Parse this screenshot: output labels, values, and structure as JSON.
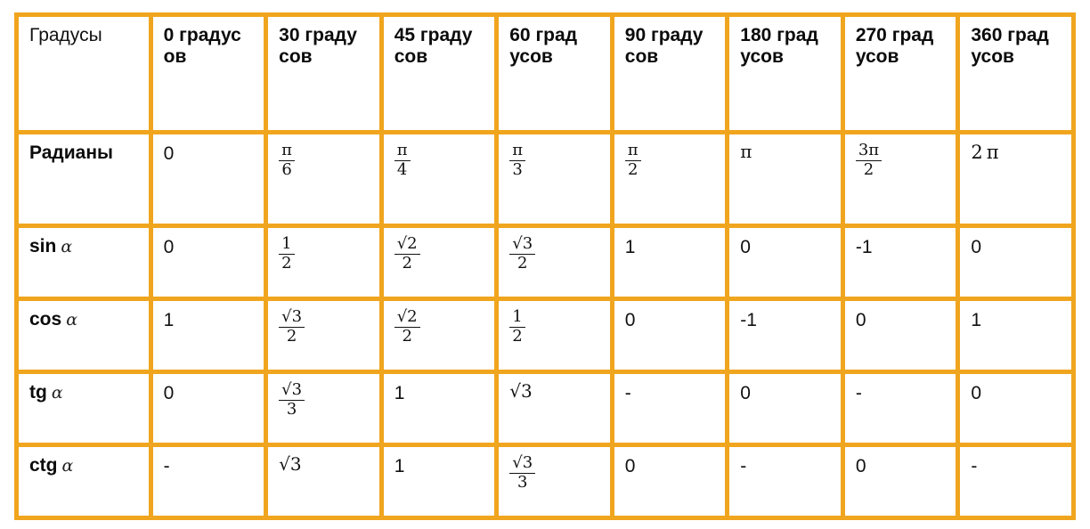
{
  "table": {
    "border_color": "#f0a51e",
    "background": "#ffffff",
    "header": {
      "label": "Градусы",
      "columns": [
        {
          "number": "0",
          "unit": "градусов"
        },
        {
          "number": "30",
          "unit": "градусов"
        },
        {
          "number": "45",
          "unit": "градусов"
        },
        {
          "number": "60",
          "unit": "градусов"
        },
        {
          "number": "90",
          "unit": "градусов"
        },
        {
          "number": "180",
          "unit": "градусов"
        },
        {
          "number": "270",
          "unit": "градусов"
        },
        {
          "number": "360",
          "unit": "градусов"
        }
      ]
    },
    "rows": [
      {
        "label": "Радианы",
        "label_alpha": "",
        "values": [
          "0",
          "π/6",
          "π/4",
          "π/3",
          "π/2",
          "π",
          "3π/2",
          "2π"
        ]
      },
      {
        "label": "sin",
        "label_alpha": "α",
        "values": [
          "0",
          "1/2",
          "√2/2",
          "√3/2",
          "1",
          "0",
          "-1",
          "0"
        ]
      },
      {
        "label": "cos",
        "label_alpha": "α",
        "values": [
          "1",
          "√3/2",
          "√2/2",
          "1/2",
          "0",
          "-1",
          "0",
          "1"
        ]
      },
      {
        "label": "tg",
        "label_alpha": "α",
        "values": [
          "0",
          "√3/3",
          "1",
          "√3",
          "-",
          "0",
          "-",
          "0"
        ]
      },
      {
        "label": "ctg",
        "label_alpha": "α",
        "values": [
          "-",
          "√3",
          "1",
          "√3/3",
          "0",
          "-",
          "0",
          "-"
        ]
      }
    ]
  },
  "cells": {
    "r0c0": "0",
    "r0c5": "π",
    "r0c7num": "2",
    "r0c7pi": "π",
    "r1c0": "0",
    "r1c4": "1",
    "r1c5": "0",
    "r1c6": "-1",
    "r1c7": "0",
    "r2c0": "1",
    "r2c4": "0",
    "r2c5": "-1",
    "r2c6": "0",
    "r2c7": "1",
    "r3c0": "0",
    "r3c2": "1",
    "r3c4": "-",
    "r3c5": "0",
    "r3c6": "-",
    "r3c7": "0",
    "r4c0": "-",
    "r4c2": "1",
    "r4c4": "0",
    "r4c5": "-",
    "r4c6": "0",
    "r4c7": "-"
  },
  "fractions": {
    "pi6": {
      "num": "π",
      "den": "6"
    },
    "pi4": {
      "num": "π",
      "den": "4"
    },
    "pi3": {
      "num": "π",
      "den": "3"
    },
    "pi2": {
      "num": "π",
      "den": "2"
    },
    "pi32": {
      "num": "3π",
      "den": "2"
    },
    "half": {
      "num": "1",
      "den": "2"
    },
    "sqrt2_2": {
      "num": "√2",
      "den": "2"
    },
    "sqrt3_2": {
      "num": "√3",
      "den": "2"
    },
    "sqrt3_3": {
      "num": "√3",
      "den": "3"
    },
    "sqrt3": {
      "num": "√3",
      "den": ""
    }
  }
}
